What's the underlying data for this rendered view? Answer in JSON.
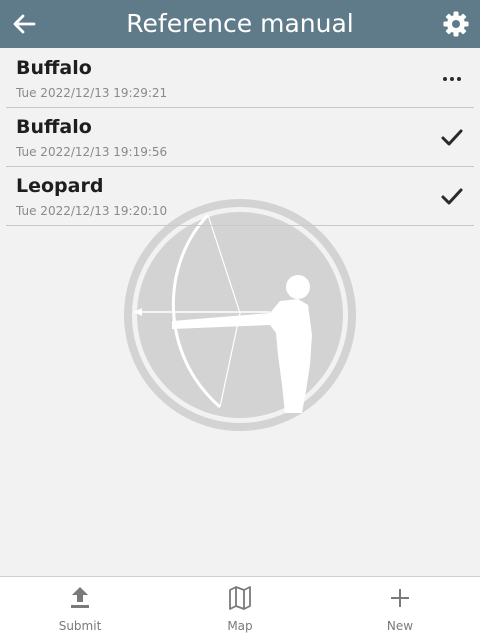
{
  "header": {
    "title": "Reference manual",
    "back_icon": "arrow-left-icon",
    "settings_icon": "gear-icon",
    "background": "#5f7a88"
  },
  "entries": [
    {
      "name": "Buffalo",
      "date": "Tue 2022/12/13 19:29:21",
      "status_icon": "more-icon"
    },
    {
      "name": "Buffalo",
      "date": "Tue 2022/12/13 19:19:56",
      "status_icon": "checkmark-icon"
    },
    {
      "name": "Leopard",
      "date": "Tue 2022/12/13 19:20:10",
      "status_icon": "checkmark-icon"
    }
  ],
  "watermark_icon": "archer-logo-icon",
  "footer": {
    "submit": {
      "label": "Submit",
      "icon": "upload-icon"
    },
    "map": {
      "label": "Map",
      "icon": "map-icon"
    },
    "new": {
      "label": "New",
      "icon": "plus-icon"
    }
  }
}
